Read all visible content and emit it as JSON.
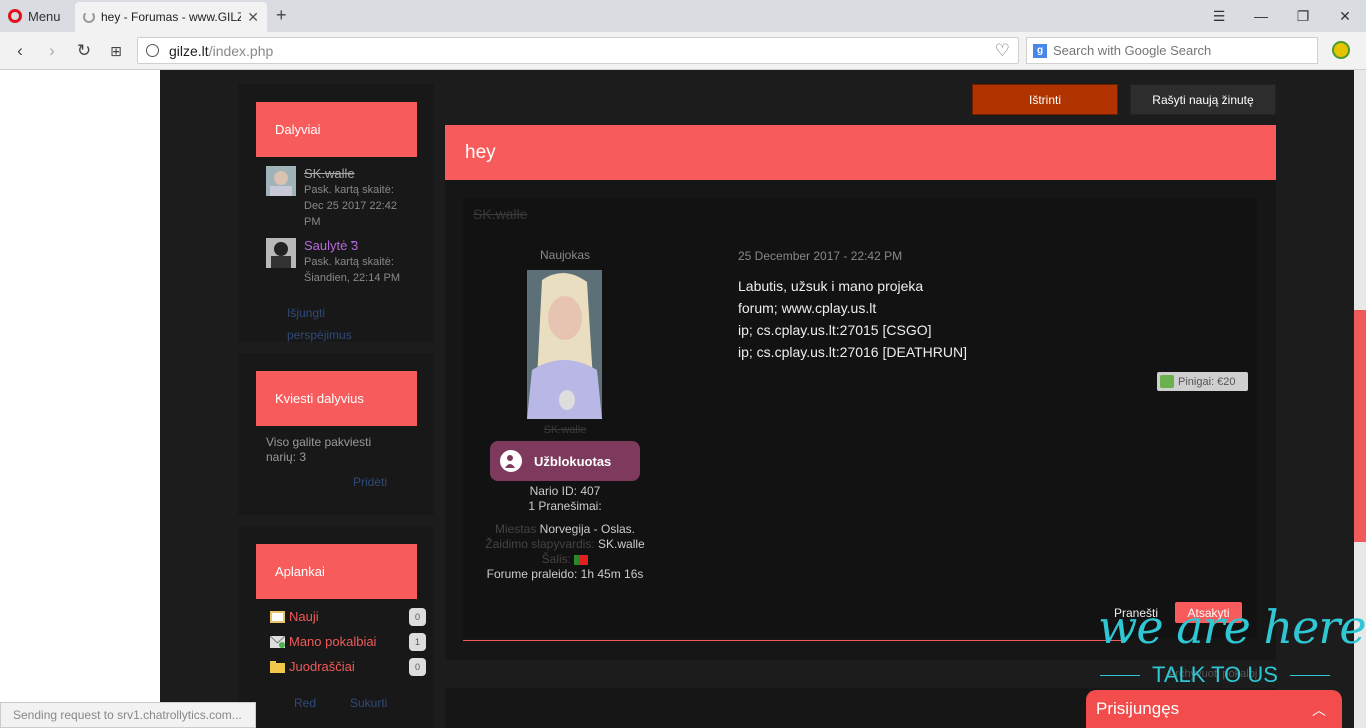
{
  "browser": {
    "menu_label": "Menu",
    "tab_title": "hey - Forumas - www.GILZE",
    "url_host": "gilze.lt",
    "url_path": "/index.php",
    "search_placeholder": "Search with Google Search"
  },
  "toolbar": {
    "delete_label": "Ištrinti",
    "write_label": "Rašyti naują žinutę"
  },
  "sidebar": {
    "members_title": "Dalyviai",
    "members": [
      {
        "name": "SK.walle",
        "seen_label": "Pask. kartą skaitė:",
        "seen_value": "Dec 25 2017 22:42 PM"
      },
      {
        "name": "Saulytė ̃3",
        "seen_label": "Pask. kartą skaitė:",
        "seen_value": "Šiandien, 22:14 PM"
      }
    ],
    "disable_warnings": "Išjungti perspėjimus",
    "invite_title": "Kviesti dalyvius",
    "invite_text": "Viso galite pakviesti narių: 3",
    "invite_add": "Pridėti",
    "folders_title": "Aplankai",
    "folders": [
      {
        "name": "Nauji",
        "count": "0"
      },
      {
        "name": "Mano pokalbiai",
        "count": "1"
      },
      {
        "name": "Juodraščiai",
        "count": "0"
      }
    ],
    "folders_edit": "Red",
    "folders_create": "Sukurti"
  },
  "topic": {
    "title": "hey"
  },
  "post": {
    "author": "SK.walle",
    "rank": "Naujokas",
    "avatar_name": "SK.walle",
    "ban_label": "Užblokuotas",
    "member_id": "Nario ID: 407",
    "posts_count": "1 Pranešimai:",
    "city_label": "Miestas",
    "city_value": "Norvegija - Oslas.",
    "game_nick_label": "Žaidimo slapyvardis:",
    "game_nick_value": "SK.walle",
    "country_label": "Šalis:",
    "time_spent": "Forume praleido: 1h 45m 16s",
    "date": "25 December 2017 - 22:42 PM",
    "body_lines": [
      "Labutis, užsuk i mano projeka",
      "forum; www.cplay.us.lt",
      "ip; cs.cplay.us.lt:27015 [CSGO]",
      "ip; cs.cplay.us.lt:27016 [DEATHRUN]"
    ],
    "money": "Pinigai: €20",
    "report_label": "Pranešti",
    "reply_label": "Atsakyti"
  },
  "archive_label": "Archyvuoti pokalbį",
  "chat_widget": {
    "tagline": "we are here",
    "sub": "TALK TO US",
    "login_label": "Prisijungęs"
  },
  "status_bar_text": "Sending request to srv1.chatrollytics.com...",
  "colors": {
    "accent": "#f75b5b",
    "delete": "#b13300",
    "chat": "#2ec7d3"
  }
}
